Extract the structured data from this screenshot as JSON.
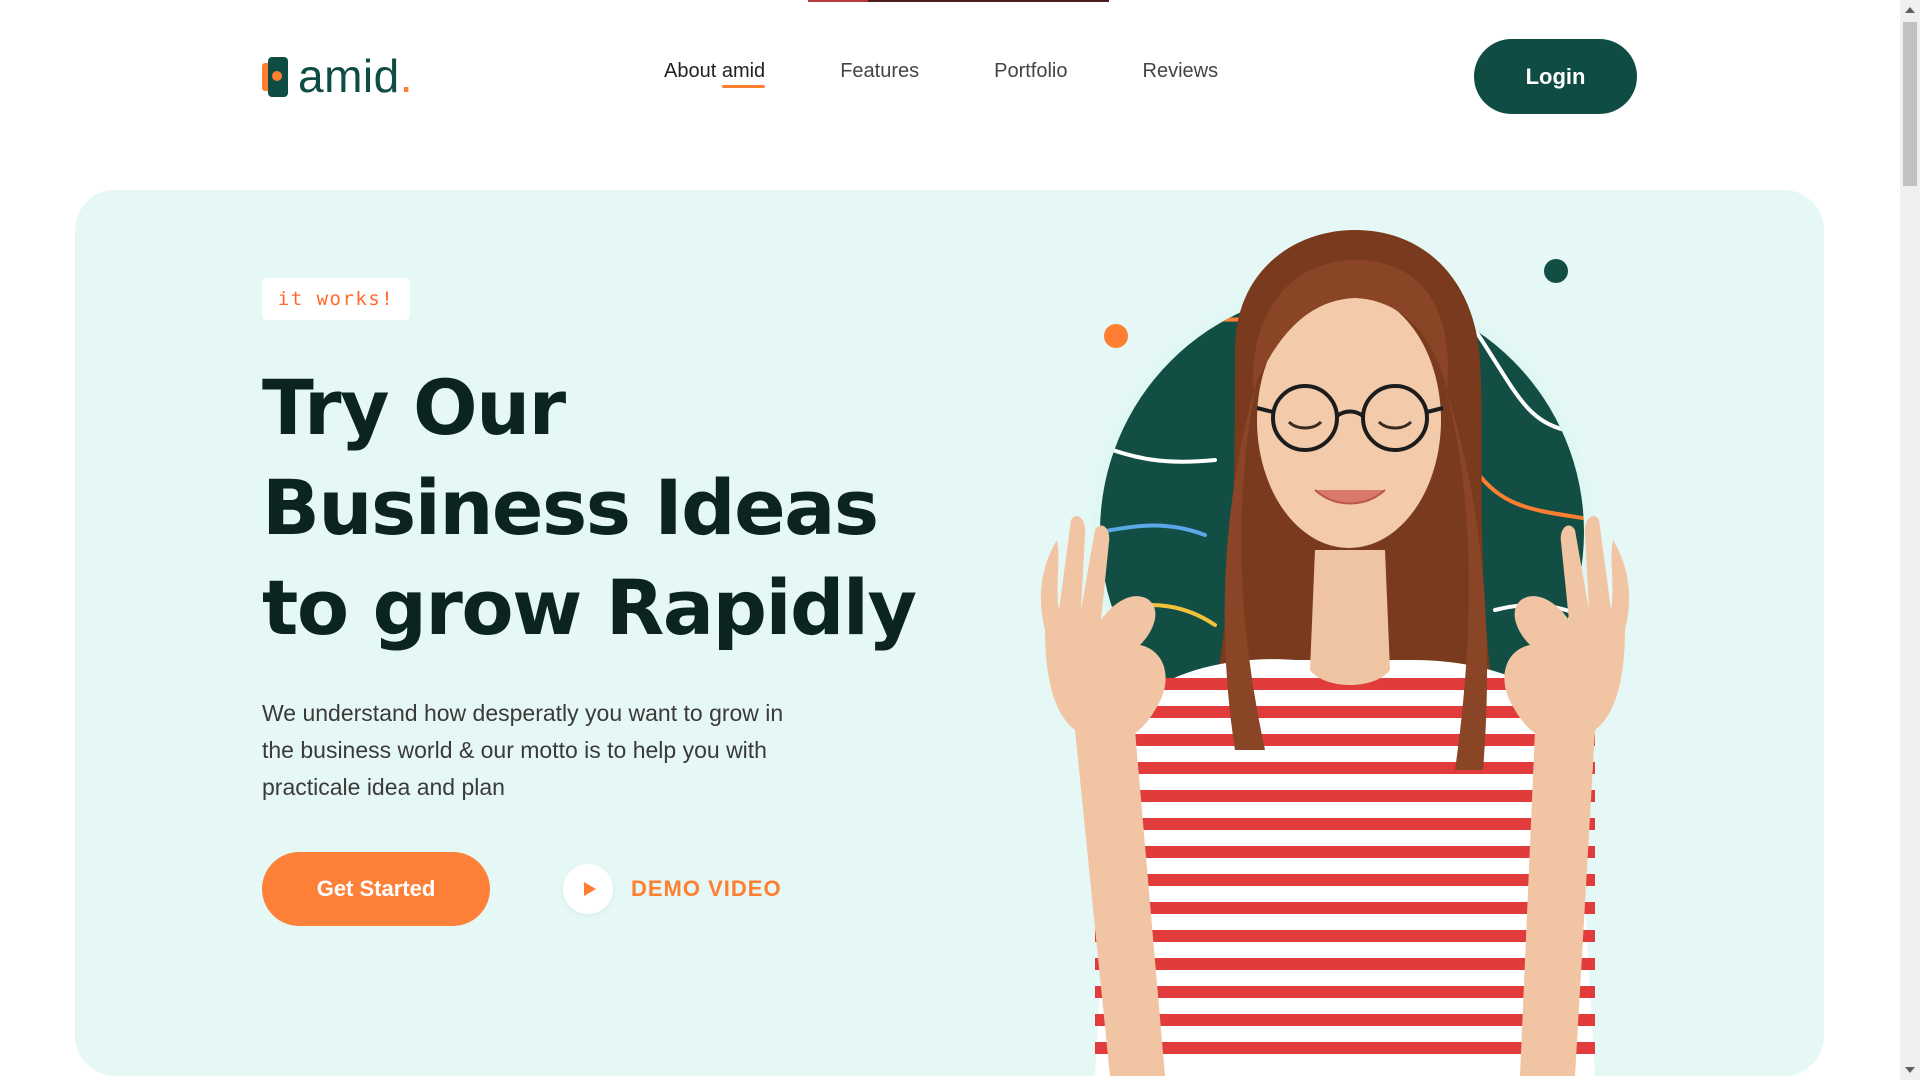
{
  "header": {
    "logo_text": "amid",
    "logo_period": ".",
    "nav": [
      {
        "label_prefix": "About ",
        "label_brand": "amid",
        "active": true
      },
      {
        "label": "Features"
      },
      {
        "label": "Portfolio"
      },
      {
        "label": "Reviews"
      }
    ],
    "login_label": "Login"
  },
  "hero": {
    "badge": "it works!",
    "headline_lines": [
      "Try Our",
      "Business Ideas",
      "to grow Rapidly"
    ],
    "description": "We understand how desperatly you want to grow in the business world & our motto is to help you with practicale idea and plan",
    "primary_cta": "Get Started",
    "demo_label": "DEMO VIDEO",
    "demo_icon": "play-icon"
  },
  "colors": {
    "brand_dark": "#0f4d44",
    "accent_orange": "#ff7f32",
    "hero_bg": "#e6f8f5",
    "headline": "#0b2420"
  }
}
